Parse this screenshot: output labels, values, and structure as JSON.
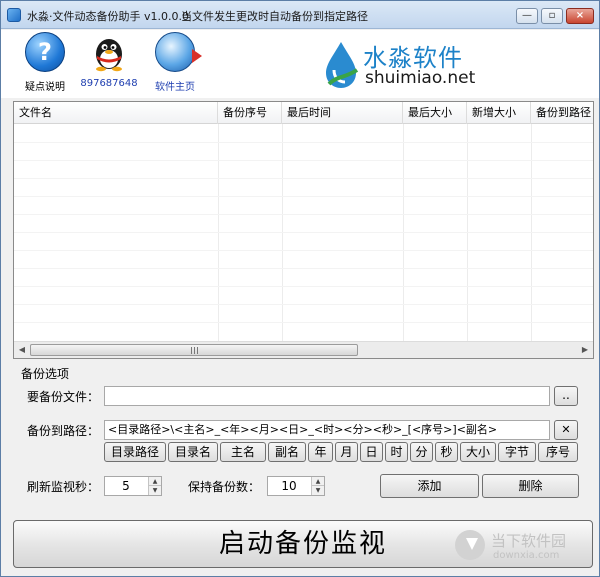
{
  "window": {
    "title": "水淼·文件动态备份助手 v1.0.0.0",
    "subtitle": "当文件发生更改时自动备份到指定路径",
    "min_glyph": "—",
    "restore_glyph": "▫",
    "close_glyph": "×"
  },
  "toolbar": {
    "help_glyph": "?",
    "help_label": "疑点说明",
    "qq_label": "897687648",
    "home_label": "软件主页"
  },
  "logo": {
    "cn": "水淼软件",
    "en": "shuimiao.net"
  },
  "list": {
    "columns": [
      "文件名",
      "备份序号",
      "最后时间",
      "最后大小",
      "新增大小",
      "备份到路径"
    ],
    "rows": [],
    "scroll_left": "◀",
    "scroll_right": "▶"
  },
  "options": {
    "section_title": "备份选项",
    "source_label": "要备份文件：",
    "source_value": "",
    "browse_label": "..",
    "dest_label": "备份到路径：",
    "dest_value": "<目录路径>\\<主名>_<年><月><日>_<时><分><秒>_[<序号>]<副名>",
    "clear_label": "✕",
    "tokens": [
      "目录路径",
      "目录名",
      "主名",
      "副名",
      "年",
      "月",
      "日",
      "时",
      "分",
      "秒",
      "大小",
      "字节",
      "序号"
    ],
    "refresh_label": "刷新监视秒：",
    "refresh_value": "5",
    "keep_label": "保持备份数：",
    "keep_value": "10",
    "add_label": "添加",
    "delete_label": "删除",
    "start_label": "启动备份监视"
  },
  "watermark": {
    "cn": "当下软件园",
    "en": "downxia.com"
  },
  "colors": {
    "accent": "#1d82c8",
    "link": "#1f3fb0"
  }
}
